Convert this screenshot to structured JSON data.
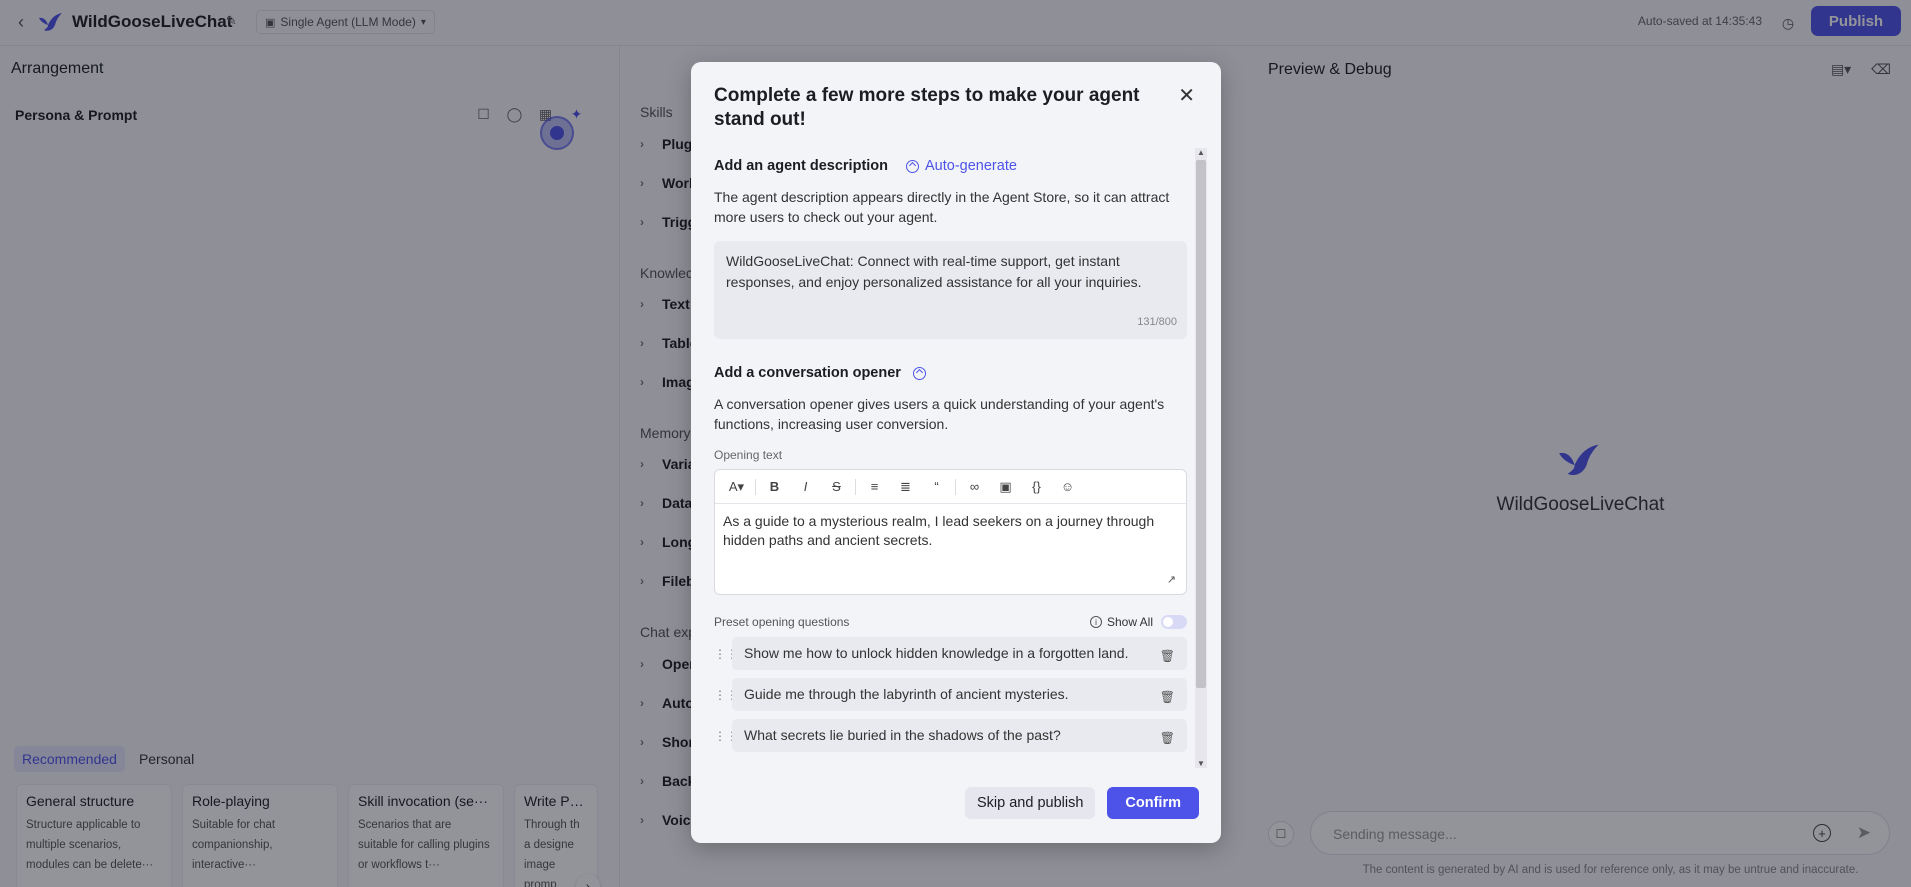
{
  "header": {
    "app_title": "WildGooseLiveChat",
    "mode": "Single Agent (LLM Mode)",
    "autosave": "Auto-saved at 14:35:43",
    "publish_label": "Publish"
  },
  "left": {
    "title": "Arrangement",
    "persona_title": "Persona & Prompt",
    "tabs": [
      "Recommended",
      "Personal"
    ],
    "active_tab": "Recommended",
    "cards": [
      {
        "title": "General structure",
        "desc": "Structure applicable to multiple scenarios, modules can be delete···"
      },
      {
        "title": "Role-playing",
        "desc": "Suitable for chat companionship, interactive···"
      },
      {
        "title": "Skill invocation (se···",
        "desc": "Scenarios that are suitable for calling plugins or workflows t···"
      },
      {
        "title": "Write Promp",
        "desc": "Through th a designe image promp"
      }
    ]
  },
  "skills": {
    "sections": [
      {
        "title": "Skills",
        "items": [
          "Plug",
          "Work",
          "Trigg"
        ]
      },
      {
        "title": "Knowlec",
        "items": [
          "Text",
          "Table",
          "Imag"
        ]
      },
      {
        "title": "Memory",
        "items": [
          "Varia",
          "Data",
          "Long",
          "Fileb"
        ]
      },
      {
        "title": "Chat exp",
        "items": [
          "Oper",
          "Auto",
          "Shor",
          "Back",
          "Voic"
        ]
      }
    ]
  },
  "right": {
    "title": "Preview & Debug",
    "agent_name": "WildGooseLiveChat",
    "send_placeholder": "Sending message...",
    "disclaimer": "The content is generated by AI and is used for reference only, as it may be untrue and inaccurate."
  },
  "modal": {
    "title": "Complete a few more steps to make your agent stand out!",
    "desc_heading": "Add an agent description",
    "auto_generate": "Auto-generate",
    "desc_help": "The agent description appears directly in the Agent Store, so it can attract more users to check out your agent.",
    "desc_value": "WildGooseLiveChat: Connect with real-time support, get instant responses, and enjoy personalized assistance for all your inquiries.",
    "desc_counter": "131/800",
    "opener_heading": "Add a conversation opener",
    "opener_help": "A conversation opener gives users a quick understanding of your agent's functions, increasing user conversion.",
    "opening_text_label": "Opening text",
    "opening_text": "As a guide to a mysterious realm, I lead seekers on a journey through hidden paths and ancient secrets.",
    "preset_label": "Preset opening questions",
    "show_all": "Show All",
    "questions": [
      "Show me how to unlock hidden knowledge in a forgotten land.",
      "Guide me through the labyrinth of ancient mysteries.",
      "What secrets lie buried in the shadows of the past?"
    ],
    "skip_label": "Skip and publish",
    "confirm_label": "Confirm"
  },
  "colors": {
    "accent": "#4d53e8",
    "overlay": "rgba(16,18,30,0.45)"
  }
}
